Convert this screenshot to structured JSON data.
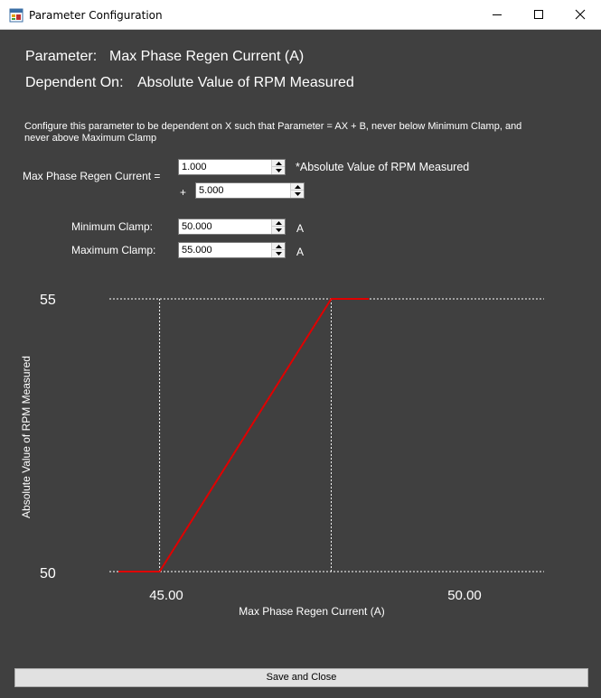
{
  "window": {
    "title": "Parameter Configuration",
    "icon": "form-app-icon",
    "controls": [
      "minimize-icon",
      "maximize-icon",
      "close-icon"
    ]
  },
  "header": {
    "parameter_label": "Parameter:",
    "parameter_value": "Max Phase Regen Current (A)",
    "dependent_label": "Dependent On:",
    "dependent_value": "Absolute Value of RPM Measured"
  },
  "instructions": {
    "line1": "Configure this parameter to be dependent on X such that Parameter = AX + B, never below Minimum Clamp, and",
    "line2": "never above Maximum Clamp"
  },
  "formula": {
    "lhs_label": "Max Phase Regen Current =",
    "a_value": "1.000",
    "a_suffix": "*Absolute Value of RPM Measured",
    "plus": "+",
    "b_value": "5.000"
  },
  "clamps": {
    "min_label": "Minimum Clamp:",
    "min_value": "50.000",
    "min_unit": "A",
    "max_label": "Maximum Clamp:",
    "max_value": "55.000",
    "max_unit": "A"
  },
  "chart_data": {
    "type": "line",
    "title": "",
    "xlabel": "Max Phase Regen Current (A)",
    "ylabel": "Absolute Value of RPM Measured",
    "x_ticks": [
      "45.00",
      "50.00"
    ],
    "y_ticks": [
      "55",
      "50"
    ],
    "xlim": [
      43.8,
      56.2
    ],
    "ylim": [
      50,
      55
    ],
    "grid": "dashed white reference lines at breakpoints",
    "series": [
      {
        "x": [
          43.8,
          45.0,
          50.0,
          51.1
        ],
        "y": [
          50,
          50,
          55,
          55
        ],
        "color": "#e00000"
      }
    ]
  },
  "footer": {
    "save_label": "Save and Close"
  }
}
